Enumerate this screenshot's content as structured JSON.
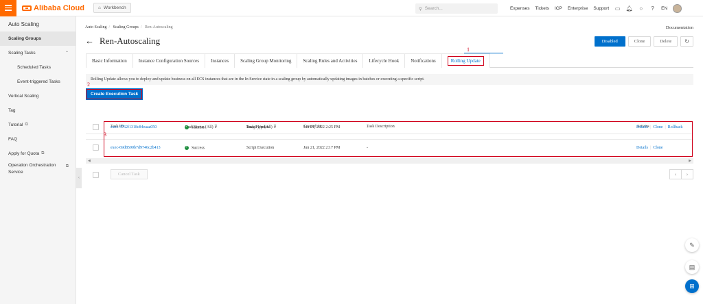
{
  "topbar": {
    "brand": "Alibaba Cloud",
    "workbench": "Workbench",
    "search_placeholder": "Search...",
    "nav": [
      "Expenses",
      "Tickets",
      "ICP",
      "Enterprise",
      "Support"
    ],
    "lang": "EN"
  },
  "sidebar": {
    "title": "Auto Scaling",
    "items": [
      {
        "label": "Scaling Groups"
      },
      {
        "label": "Scaling Tasks"
      },
      {
        "label": "Scheduled Tasks"
      },
      {
        "label": "Event-triggered Tasks"
      },
      {
        "label": "Vertical Scaling"
      },
      {
        "label": "Tag"
      },
      {
        "label": "Tutorial"
      },
      {
        "label": "FAQ"
      },
      {
        "label": "Apply for Quota"
      },
      {
        "label": "Operation Orchestration Service"
      }
    ]
  },
  "breadcrumb": [
    "Auto Scaling",
    "Scaling Groups",
    "Ren-Autoscaling"
  ],
  "documentation": "Documentation",
  "page_title": "Ren-Autoscaling",
  "actions": {
    "disabled": "Disabled",
    "clone": "Clone",
    "delete": "Delete"
  },
  "tabs": [
    "Basic Information",
    "Instance Configuration Sources",
    "Instances",
    "Scaling Group Monitoring",
    "Scaling Rules and Activities",
    "Lifecycle Hook",
    "Notifications",
    "Rolling Update"
  ],
  "annotations": {
    "a1": "1",
    "a2": "2",
    "a3": "3"
  },
  "info_text": "Rolling Update allows you to deploy and update business on all ECS instances that are in the In Service state in a scaling group by automatically updating images in batches or executing a specific script.",
  "create_button": "Create Execution Task",
  "table": {
    "headers": {
      "task_id": "Task ID",
      "status": "Task Status (All)",
      "type": "Task Type (All)",
      "created": "Created At",
      "desc": "Task Description",
      "actions": "Actions"
    },
    "rows": [
      {
        "task_id": "exec-4762f1318c84eaaa050",
        "status": "Success",
        "type": "Image Update",
        "created": "Jun 21, 2022 2:25 PM",
        "desc": "-",
        "actions": [
          "Details",
          "Clone",
          "Rollback"
        ]
      },
      {
        "task_id": "exec-69d8590b7d9746c2b413",
        "status": "Success",
        "type": "Script Execution",
        "created": "Jun 21, 2022 2:17 PM",
        "desc": "-",
        "actions": [
          "Details",
          "Clone"
        ]
      }
    ]
  },
  "cancel_button": "Cancel Task",
  "colors": {
    "brand": "#ff6a00",
    "primary": "#0070cc",
    "annotation": "#d0021b",
    "success": "#1e8e3e"
  }
}
